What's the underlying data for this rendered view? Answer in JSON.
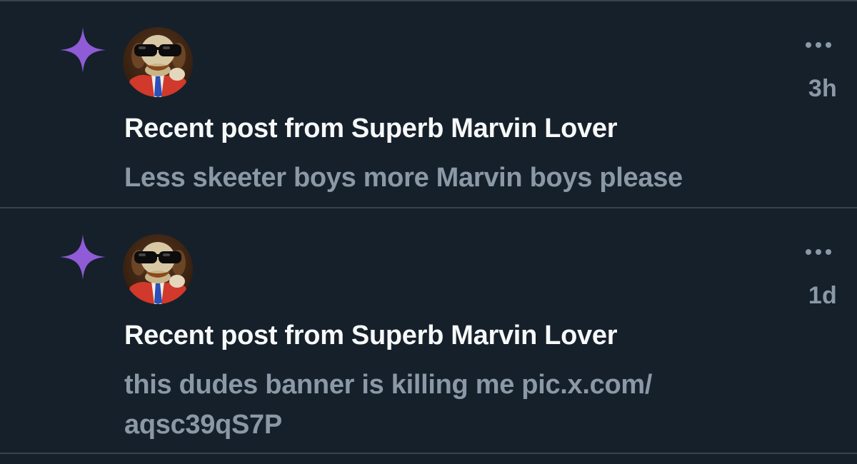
{
  "colors": {
    "background": "#15202b",
    "divider": "#38444d",
    "title": "#f7f9f9",
    "secondary": "#8b98a5",
    "sparkle": "#8f5bd6"
  },
  "notifications": [
    {
      "icon": "sparkle-icon",
      "avatar": "profile-avatar",
      "time": "3h",
      "title": "Recent post from Superb Marvin Lover",
      "body": "Less skeeter boys more Marvin boys please"
    },
    {
      "icon": "sparkle-icon",
      "avatar": "profile-avatar",
      "time": "1d",
      "title": "Recent post from Superb Marvin Lover",
      "body": "this dudes banner is killing me pic.x.com/ aqsc39qS7P"
    }
  ]
}
